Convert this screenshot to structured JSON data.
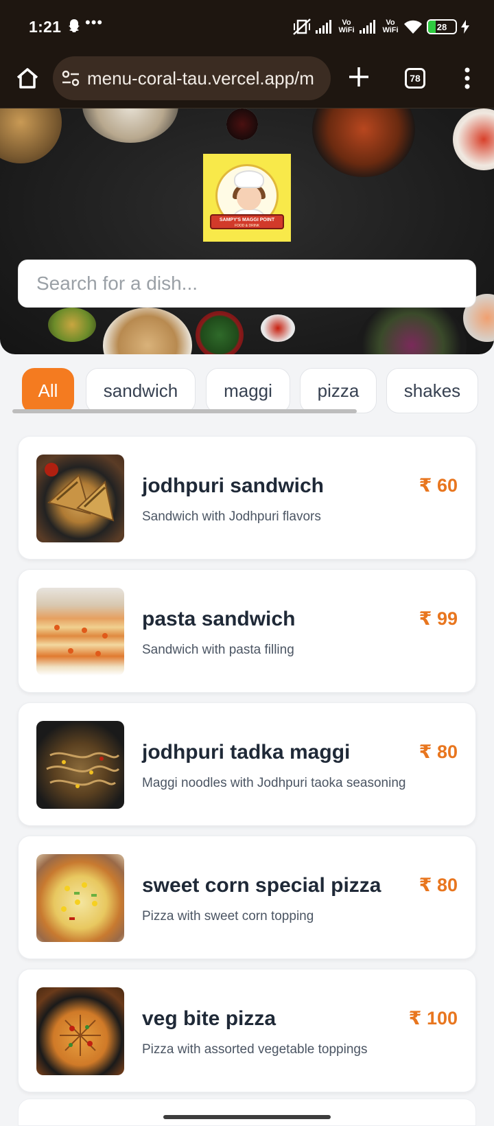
{
  "status_bar": {
    "time": "1:21",
    "dots": "•••",
    "vowifi_1": "Vo WiFi",
    "vowifi_2": "Vo WiFi",
    "battery": "28"
  },
  "browser": {
    "url": "menu-coral-tau.vercel.app/m",
    "tab_count": "78"
  },
  "logo": {
    "name": "SAMPY'S MAGGI POINT",
    "tagline": "FOOD & DRINK"
  },
  "search": {
    "placeholder": "Search for a dish...",
    "value": ""
  },
  "categories": [
    {
      "label": "All",
      "active": true
    },
    {
      "label": "sandwich",
      "active": false
    },
    {
      "label": "maggi",
      "active": false
    },
    {
      "label": "pizza",
      "active": false
    },
    {
      "label": "shakes",
      "active": false
    }
  ],
  "menu_items": [
    {
      "name": "jodhpuri sandwich",
      "description": "Sandwich with Jodhpuri flavors",
      "price": "₹ 60"
    },
    {
      "name": "pasta sandwich",
      "description": "Sandwich with pasta filling",
      "price": "₹ 99"
    },
    {
      "name": "jodhpuri tadka maggi",
      "description": "Maggi noodles with Jodhpuri taoka seasoning",
      "price": "₹ 80"
    },
    {
      "name": "sweet corn special pizza",
      "description": "Pizza with sweet corn topping",
      "price": "₹ 80"
    },
    {
      "name": "veg bite pizza",
      "description": "Pizza with assorted vegetable toppings",
      "price": "₹ 100"
    }
  ],
  "colors": {
    "accent": "#f47b20",
    "price": "#e8761f",
    "browser_bg": "#1e1610"
  }
}
